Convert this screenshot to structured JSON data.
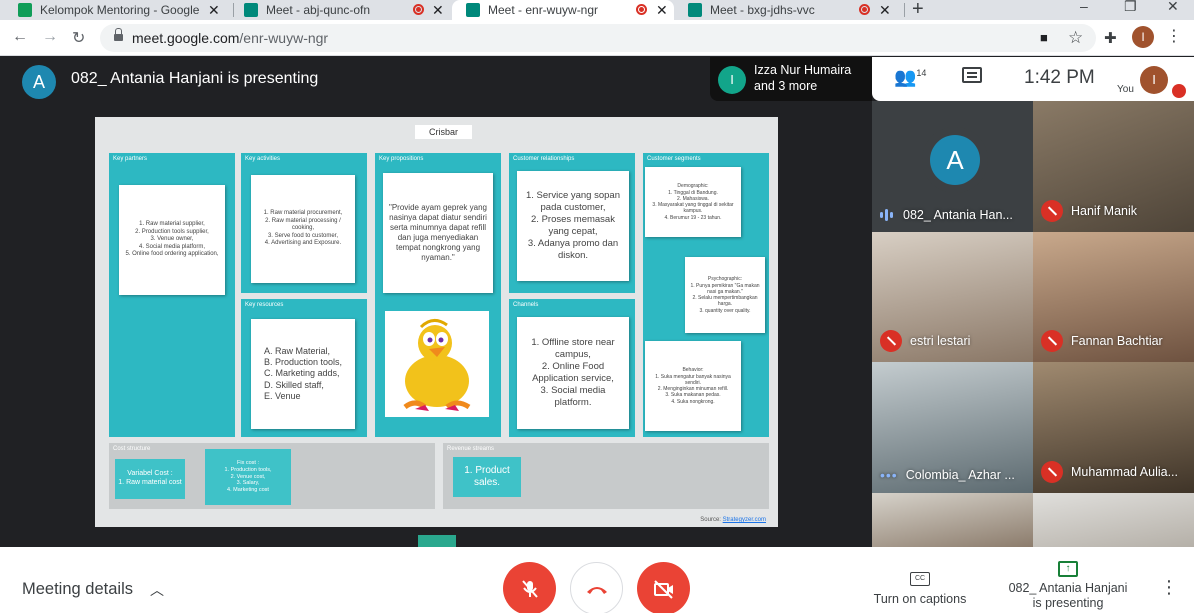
{
  "browser": {
    "tabs": [
      {
        "title": "Kelompok Mentoring - Google Sl",
        "favicon_color": "#0f9d58",
        "active": false,
        "recording": false
      },
      {
        "title": "Meet - abj-qunc-ofn",
        "favicon_color": "#00897b",
        "active": false,
        "recording": true
      },
      {
        "title": "Meet - enr-wuyw-ngr",
        "favicon_color": "#00897b",
        "active": true,
        "recording": true
      },
      {
        "title": "Meet - bxg-jdhs-vvc",
        "favicon_color": "#00897b",
        "active": false,
        "recording": true
      }
    ],
    "url_host": "meet.google.com",
    "url_path": "/enr-wuyw-ngr",
    "profile_initial": "I"
  },
  "meet": {
    "presenter_initial": "A",
    "presenting_title": "082_ Antania Hanjani is presenting",
    "speaker_initial": "I",
    "speaker_line1": "Izza Nur Humaira",
    "speaker_line2": "and 3 more",
    "participant_count": "14",
    "time": "1:42 PM",
    "you_label": "You",
    "you_initial": "I"
  },
  "slide": {
    "title": "Crisbar",
    "key_partners": {
      "header": "Key partners",
      "note": "1. Raw material supplier,\n2. Production tools supplier,\n3. Venue owner,\n4. Social media platform,\n5. Online food ordering application,"
    },
    "key_activities": {
      "header": "Key activities",
      "note": "1. Raw material procurement,\n2. Raw material processing / cooking,\n3. Serve food to customer,\n4. Advertising and Exposure."
    },
    "key_resources": {
      "header": "Key resources",
      "note": "A. Raw Material,\nB. Production tools,\nC. Marketing adds,\nD. Skilled staff,\nE. Venue"
    },
    "value_propositions": {
      "header": "Key propositions",
      "note": "\"Provide ayam geprek yang nasinya dapat diatur sendiri serta minumnya dapat refill dan juga menyediakan tempat nongkrong yang nyaman.\""
    },
    "customer_relationships": {
      "header": "Customer relationships",
      "note": "1. Service yang sopan pada customer,\n2. Proses memasak yang cepat,\n3. Adanya promo dan diskon."
    },
    "channels": {
      "header": "Channels",
      "note": "1. Offline store near campus,\n2. Online Food Application service,\n3. Social media platform."
    },
    "customer_segments": {
      "header": "Customer segments",
      "demographic": "Demographic:\n1. Tinggal di Bandung.\n2. Mahasiswa.\n3. Masyarakat yang tinggal di sekitar kampus.\n4. Berumur 19 - 23 tahun.",
      "psychographic": "Psychographic:\n1. Punya pemikiran \"Ga makan nasi ga makan.\"\n2. Selalu mempertimbangkan harga.\n3. quantity over quality.",
      "behavior": "Behavior:\n1. Suka mengatur banyak nasinya sendiri.\n2. Menginginkan minuman refill.\n3. Suka makanan pedas.\n4. Suka nongkrong."
    },
    "cost_structure": {
      "header": "Cost structure",
      "variable": "Variabel Cost :\n1. Raw material cost",
      "fixed": "Fix cost :\n1. Production tools,\n2. Venue cost,\n3. Salary,\n4. Marketing cost"
    },
    "revenue_streams": {
      "header": "Revenue streams",
      "note": "1. Product sales."
    },
    "source_label": "Source:",
    "source_link": "Strategyzer.com"
  },
  "participants": [
    {
      "name": "082_ Antania Han...",
      "status": "talking",
      "initial": "A",
      "bg": "#3c4043"
    },
    {
      "name": "Hanif Manik",
      "status": "muted",
      "bg": "#6b5a4a"
    },
    {
      "name": "estri lestari",
      "status": "muted",
      "bg": "#9a8a78"
    },
    {
      "name": "Fannan Bachtiar",
      "status": "muted",
      "bg": "#b08a6e"
    },
    {
      "name": "Colombia_ Azhar ...",
      "status": "dots",
      "bg": "#8d9aa0"
    },
    {
      "name": "Muhammad Aulia...",
      "status": "muted",
      "bg": "#7a6650"
    },
    {
      "name": "",
      "status": "none",
      "bg": "#b8b4ac"
    },
    {
      "name": "",
      "status": "none",
      "bg": "#d0cfcc"
    }
  ],
  "bottom_bar": {
    "meeting_details": "Meeting details",
    "captions_label": "Turn on captions",
    "captions_icon": "CC",
    "presenting_line1": "082_ Antania Hanjani",
    "presenting_line2": "is presenting"
  },
  "colors": {
    "accent_red": "#ea4335",
    "teal_block": "#2db8c2",
    "meet_bg": "#202124"
  }
}
